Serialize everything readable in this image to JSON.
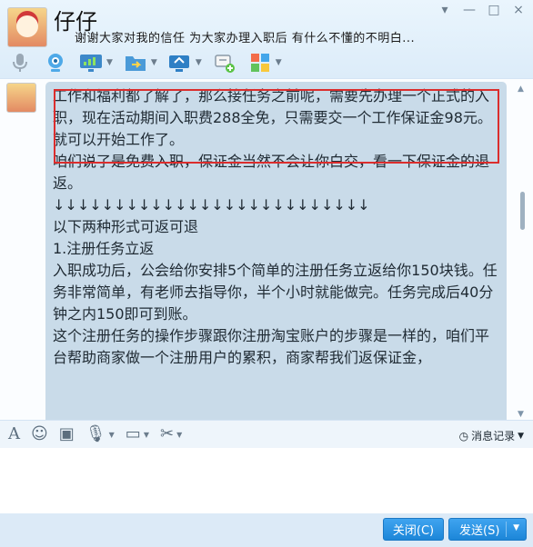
{
  "contact": {
    "name": "仔仔",
    "signature": "谢谢大家对我的信任   为大家办理入职后   有什么不懂的不明白..."
  },
  "window_controls": [
    "▾",
    "—",
    "□",
    "×"
  ],
  "chat": {
    "highlighted_paragraph": "工作和福利都了解了，那么接任务之前呢，需要先办理一个正式的入职，现在活动期间入职费288全免，只需要交一个工作保证金98元。就可以开始工作了。",
    "paragraphs": [
      "咱们说了是免费入职，保证金当然不会让你白交，看一下保证金的退返。",
      "↓↓↓↓↓↓↓↓↓↓↓↓↓↓↓↓↓↓↓↓↓↓↓↓↓↓",
      "以下两种形式可返可退",
      "1.注册任务立返",
      "入职成功后，公会给你安排5个简单的注册任务立返给你150块钱。任务非常简单，有老师去指导你，半个小时就能做完。任务完成后40分钟之内150即可到账。",
      "这个注册任务的操作步骤跟你注册淘宝账户的步骤是一样的，咱们平台帮助商家做一个注册用户的累积，商家帮我们返保证金，"
    ]
  },
  "input_toolbar": {
    "history_label": "消息记录"
  },
  "footer": {
    "close_label": "关闭(C)",
    "send_label": "发送(S)"
  }
}
